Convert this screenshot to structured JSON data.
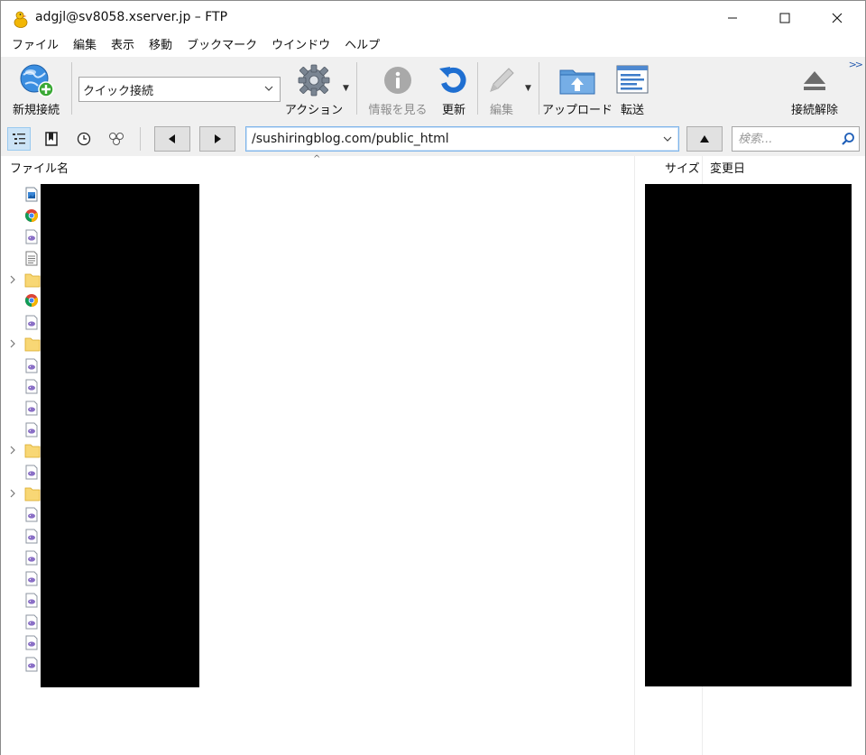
{
  "window": {
    "title": "adgjl@sv8058.xserver.jp – FTP"
  },
  "menu": {
    "items": [
      "ファイル",
      "編集",
      "表示",
      "移動",
      "ブックマーク",
      "ウインドウ",
      "ヘルプ"
    ]
  },
  "toolbar": {
    "new_connection": "新規接続",
    "quick_connect": "クイック接続",
    "action": "アクション",
    "info": "情報を見る",
    "refresh": "更新",
    "edit": "編集",
    "upload": "アップロード",
    "transfer": "転送",
    "disconnect": "接続解除"
  },
  "navbar": {
    "path": "/sushiringblog.com/public_html",
    "search_placeholder": "検索..."
  },
  "list": {
    "columns": {
      "name": "ファイル名",
      "size": "サイズ",
      "modified": "変更日"
    },
    "rows": [
      {
        "type": "image",
        "expandable": false
      },
      {
        "type": "chrome",
        "expandable": false
      },
      {
        "type": "php",
        "expandable": false
      },
      {
        "type": "text",
        "expandable": false
      },
      {
        "type": "folder",
        "expandable": true
      },
      {
        "type": "chrome",
        "expandable": false
      },
      {
        "type": "php",
        "expandable": false
      },
      {
        "type": "folder",
        "expandable": true
      },
      {
        "type": "php",
        "expandable": false
      },
      {
        "type": "php",
        "expandable": false
      },
      {
        "type": "php",
        "expandable": false
      },
      {
        "type": "php",
        "expandable": false
      },
      {
        "type": "folder",
        "expandable": true
      },
      {
        "type": "php",
        "expandable": false
      },
      {
        "type": "folder",
        "expandable": true
      },
      {
        "type": "php",
        "expandable": false
      },
      {
        "type": "php",
        "expandable": false
      },
      {
        "type": "php",
        "expandable": false
      },
      {
        "type": "php",
        "expandable": false
      },
      {
        "type": "php",
        "expandable": false
      },
      {
        "type": "php",
        "expandable": false
      },
      {
        "type": "php",
        "expandable": false
      },
      {
        "type": "php",
        "expandable": false
      }
    ]
  },
  "colors": {
    "toolbar_bg": "#f0f0f0",
    "accent_blue": "#2a7ad5",
    "folder": "#f8d775",
    "php": "#8a6fc6",
    "redaction": "#000000"
  }
}
